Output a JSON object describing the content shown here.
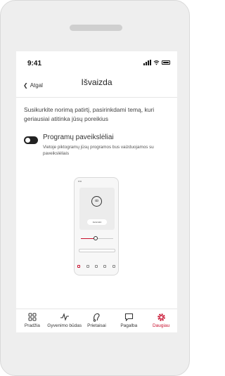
{
  "status_bar": {
    "time": "9:41"
  },
  "header": {
    "back_label": "Atgal",
    "title": "Išvaizda"
  },
  "intro_text": "Susikurkite norimą patirtį, pasirinkdami temą, kuri geriausiai atitinka jūsų poreikius",
  "setting": {
    "title": "Programų paveikslėliai",
    "description": "Vietoje piktogramų jūsų programos bus vaizduojamos su paveikslėliais",
    "enabled": false
  },
  "preview": {
    "time": "9:41",
    "logo_text": "ꝏ",
    "mode_label": "Automatic",
    "slider_level": 0.45
  },
  "tabbar": {
    "items": [
      {
        "label": "Pradžia",
        "icon": "grid-icon",
        "active": false
      },
      {
        "label": "Gyvenimo būdas",
        "icon": "activity-icon",
        "active": false
      },
      {
        "label": "Prietaisai",
        "icon": "hearing-aid-icon",
        "active": false
      },
      {
        "label": "Pagalba",
        "icon": "chat-bubble-icon",
        "active": false
      },
      {
        "label": "Daugiau",
        "icon": "gear-icon",
        "active": true
      }
    ],
    "active_color": "#c8102e"
  }
}
